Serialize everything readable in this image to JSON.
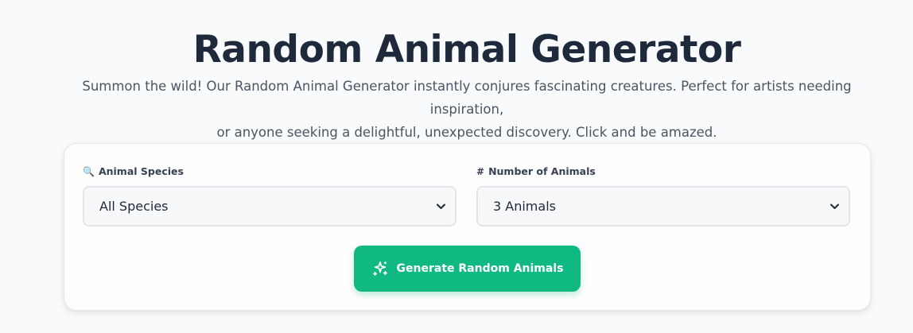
{
  "header": {
    "title": "Random Animal Generator",
    "subtitle_line1": "Summon the wild! Our Random Animal Generator instantly conjures fascinating creatures. Perfect for artists needing inspiration,",
    "subtitle_line2": "or anyone seeking a delightful, unexpected discovery. Click and be amazed."
  },
  "form": {
    "species": {
      "icon": "magnifier-icon",
      "icon_glyph": "🔍",
      "label": "Animal Species",
      "selected": "All Species"
    },
    "count": {
      "icon_glyph": "#",
      "label": "Number of Animals",
      "selected": "3 Animals"
    },
    "generate_button": {
      "icon": "sparkles-icon",
      "label": "Generate Random Animals"
    }
  },
  "colors": {
    "accent": "#10b981",
    "title": "#1e293b",
    "background": "#f9fafb"
  }
}
